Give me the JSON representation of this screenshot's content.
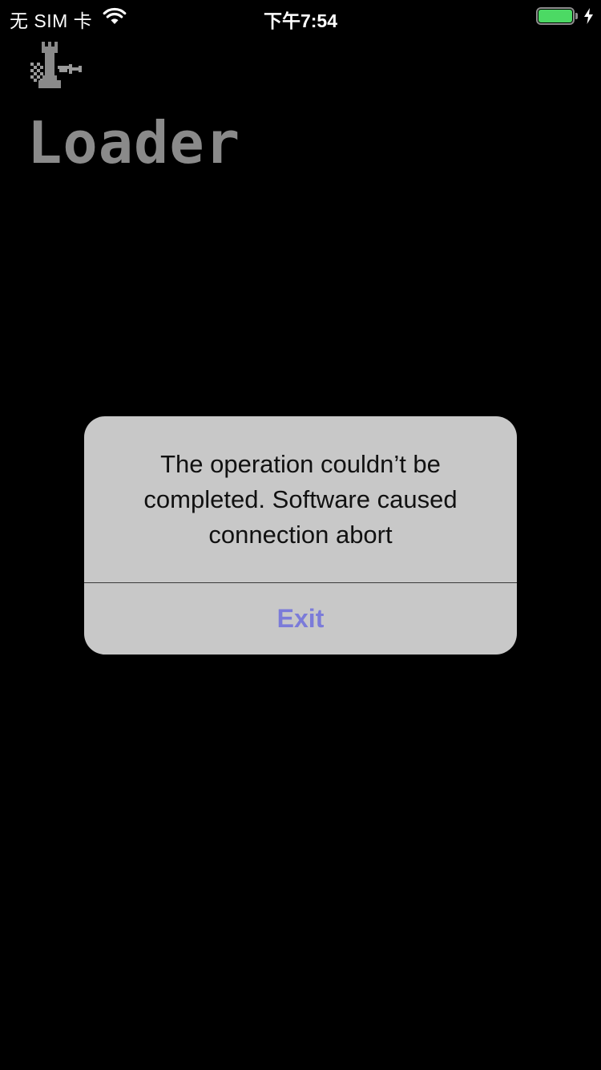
{
  "status_bar": {
    "carrier": "无 SIM 卡",
    "time": "下午7:54",
    "battery_level": 1.0,
    "charging": true,
    "wifi_icon": "wifi-icon",
    "battery_icon": "battery-icon",
    "charging_icon": "lightning-bolt-icon"
  },
  "app": {
    "logo_icon": "chess-rook-logo-icon",
    "title": "Loader"
  },
  "alert": {
    "message": "The operation couldn’t be completed. Software caused connection abort",
    "button_label": "Exit",
    "button_color": "#7b7bd9"
  },
  "colors": {
    "background": "#000000",
    "alert_background": "#c8c8c8",
    "title_color": "#8a8a8a",
    "battery_fill": "#4cd964"
  }
}
